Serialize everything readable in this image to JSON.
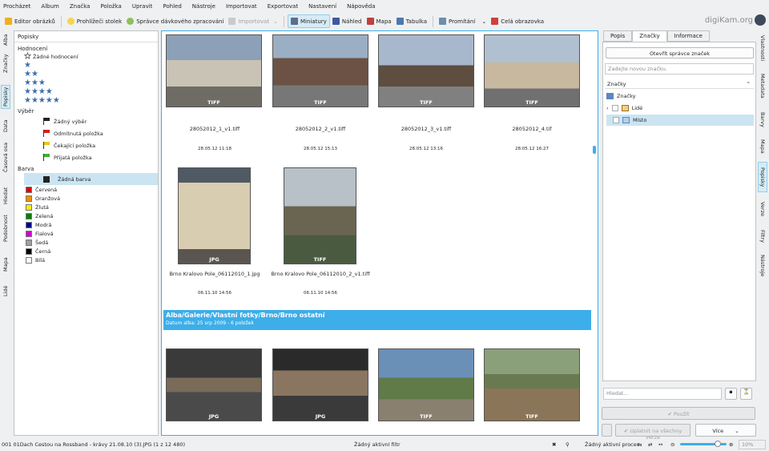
{
  "menu": [
    "Procházet",
    "Album",
    "Značka",
    "Položka",
    "Upravit",
    "Pohled",
    "Nástroje",
    "Importovat",
    "Exportovat",
    "Nastavení",
    "Nápověda"
  ],
  "toolbar": {
    "image_editor": "Editor obrázků",
    "light_table": "Prohlížeči stolek",
    "batch_manager": "Správce dávkového zpracování",
    "import": "Importovat",
    "thumbnails": "Miniatury",
    "preview": "Náhled",
    "map": "Mapa",
    "table": "Tabulka",
    "slideshow": "Promítání",
    "fullscreen": "Celá obrazovka"
  },
  "brand": "digiKam.org",
  "left_tabs": [
    "Alba",
    "Značky",
    "Popisky",
    "Data",
    "Časová osa",
    "Hledat",
    "Podobnost",
    "Mapa",
    "Lidé"
  ],
  "labels_panel": {
    "title": "Popisky",
    "rating_header": "Hodnocení",
    "no_rating": "Žádné hodnocení",
    "pick_header": "Výběr",
    "picks": [
      "Žádný výběr",
      "Odmítnutá položka",
      "Čekající položka",
      "Přijatá položka"
    ],
    "color_header": "Barva",
    "colors": [
      {
        "name": "Žádná barva",
        "hex": "#ffffff"
      },
      {
        "name": "Červená",
        "hex": "#e00000"
      },
      {
        "name": "Oranžová",
        "hex": "#f09000"
      },
      {
        "name": "Žlutá",
        "hex": "#f8f000"
      },
      {
        "name": "Zelená",
        "hex": "#008000"
      },
      {
        "name": "Modrá",
        "hex": "#00008c"
      },
      {
        "name": "Fialová",
        "hex": "#d000d0"
      },
      {
        "name": "Šedá",
        "hex": "#a0a0a0"
      },
      {
        "name": "Černá",
        "hex": "#000000"
      },
      {
        "name": "Bílá",
        "hex": "#ffffff"
      }
    ]
  },
  "items": [
    {
      "name": "28052012_1_v1.tiff",
      "date": "28.05.12 11:18",
      "format": "TIFF"
    },
    {
      "name": "28052012_2_v1.tiff",
      "date": "28.05.12 15:13",
      "format": "TIFF"
    },
    {
      "name": "28052012_3_v1.tiff",
      "date": "28.05.12 13:16",
      "format": "TIFF"
    },
    {
      "name": "28052012_4.tif",
      "date": "28.05.12 16:27",
      "format": "TIFF"
    },
    {
      "name": "Brno Kralovo Pole_06112010_1.jpg",
      "date": "06.11.10 14:56",
      "format": "JPG"
    },
    {
      "name": "Brno Kralovo Pole_06112010_2_v1.tiff",
      "date": "06.11.10 14:56",
      "format": "TIFF"
    }
  ],
  "album": {
    "path": "Alba/Galerie/Vlastní fotky/Brno/Brno ostatní",
    "info": "Datum alba: 25 srp 2009 - 6 položek"
  },
  "album_items": [
    {
      "format": "JPG"
    },
    {
      "format": "JPG"
    },
    {
      "format": "TIFF"
    },
    {
      "format": "TIFF"
    }
  ],
  "right_panel": {
    "tabs": [
      "Popis",
      "Značky",
      "Informace"
    ],
    "open_manager": "Otevřít správce značek",
    "new_tag_placeholder": "Zadejte novou značku.",
    "tags_header": "Značky",
    "tree_root": "Značky",
    "tag_people": "Lidé",
    "tag_place": "Místo",
    "search_placeholder": "Hledat...",
    "apply": "Použít",
    "apply_all": "Uplatnit na všechny verze",
    "more": "Více"
  },
  "right_tabs": [
    "Vlastnosti",
    "Metadata",
    "Barvy",
    "Mapa",
    "Popisky",
    "Verze",
    "Filtry",
    "Nástroje"
  ],
  "status": {
    "left": "001 01Dach Cestou na Rossband - krávy 21.08.10 (3).JPG (1 z 12 480)",
    "filter": "Žádný aktivní filtr",
    "process": "Žádný aktivní proces",
    "zoom": "10%"
  }
}
